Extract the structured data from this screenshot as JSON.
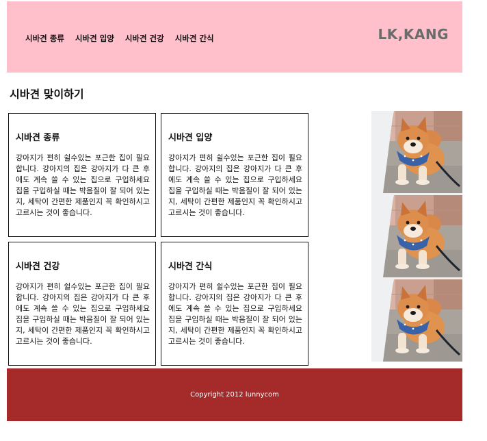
{
  "header": {
    "nav": [
      "시바견 종류",
      "시바견 입양",
      "시바견 건강",
      "시바견 간식"
    ],
    "logo": "LK,KANG"
  },
  "main": {
    "title": "시바견 맞이하기",
    "cards": [
      {
        "title": "시바견 종류",
        "body": "강아지가 편히 쉴수있는 포근한 집이 필요합니다. 강아지의 집은 강아지가 다 큰 후에도 계속 쓸 수 있는 집으로 구입하세요 집을 구입하실 때는 박음질이 잘 되어 있는지, 세탁이 간편한 제품인지 꼭 확인하시고 고르시는 것이 좋습니다."
      },
      {
        "title": "시바견 입양",
        "body": "강아지가 편히 쉴수있는 포근한 집이 필요합니다. 강아지의 집은 강아지가 다 큰 후에도 계속 쓸 수 있는 집으로 구입하세요 집을 구입하실 때는 박음질이 잘 되어 있는지, 세탁이 간편한 제품인지 꼭 확인하시고 고르시는 것이 좋습니다."
      },
      {
        "title": "시바견 건강",
        "body": "강아지가 편히 쉴수있는 포근한 집이 필요합니다. 강아지의 집은 강아지가 다 큰 후에도 계속 쓸 수 있는 집으로 구입하세요 집을 구입하실 때는 박음질이 잘 되어 있는지, 세탁이 간편한 제품인지 꼭 확인하시고 고르시는 것이 좋습니다."
      },
      {
        "title": "시바견 간식",
        "body": "강아지가 편히 쉴수있는 포근한 집이 필요합니다. 강아지의 집은 강아지가 다 큰 후에도 계속 쓸 수 있는 집으로 구입하세요 집을 구입하실 때는 박음질이 잘 되어 있는지, 세탁이 간편한 제품인지 꼭 확인하시고 고르시는 것이 좋습니다."
      }
    ]
  },
  "footer": {
    "copyright": "Copyright 2012 lunnycom"
  },
  "colors": {
    "header_bg": "#ffc0cb",
    "footer_bg": "#a52a2a",
    "logo": "#6b6b6b"
  }
}
